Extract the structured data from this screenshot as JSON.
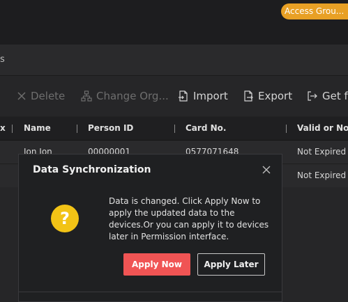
{
  "header": {
    "access_badge": "Access Grou..."
  },
  "tabs": {
    "fragment": "s"
  },
  "toolbar": {
    "delete_label": "Delete",
    "change_org_label": "Change Org...",
    "import_label": "Import",
    "export_label": "Export",
    "get_from_label": "Get fr"
  },
  "table": {
    "columns": [
      "x",
      "Name",
      "Person ID",
      "Card No.",
      "Valid or Not"
    ],
    "rows": [
      {
        "name": "Jon Jon",
        "person_id": "00000001",
        "card_no": "0577071648",
        "valid": "Not Expired"
      },
      {
        "valid": "Not Expired"
      }
    ]
  },
  "dialog": {
    "title": "Data Synchronization",
    "message": "Data is changed. Click Apply Now to apply the updated data to the devices.Or you can apply it to devices later in Permission interface.",
    "icon_glyph": "?",
    "apply_now_label": "Apply Now",
    "apply_later_label": "Apply Later"
  },
  "colors": {
    "accent": "#e8a025",
    "primary_button": "#f05454",
    "warning_icon": "#f2c316"
  }
}
